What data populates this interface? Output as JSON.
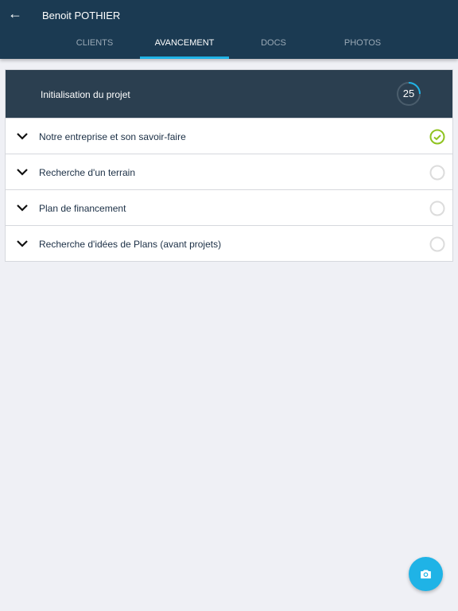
{
  "header": {
    "title": "Benoit POTHIER",
    "back_icon": "arrow-left-icon"
  },
  "tabs": [
    {
      "label": "CLIENTS"
    },
    {
      "label": "AVANCEMENT",
      "active": true
    },
    {
      "label": "DOCS"
    },
    {
      "label": "PHOTOS"
    }
  ],
  "section": {
    "title": "Initialisation du projet",
    "progress": 25,
    "progress_color": "#1fb3e6"
  },
  "items": [
    {
      "label": "Notre entreprise et son savoir-faire",
      "done": true
    },
    {
      "label": "Recherche d'un terrain",
      "done": false
    },
    {
      "label": "Plan de financement",
      "done": false
    },
    {
      "label": "Recherche d'idées de Plans (avant projets)",
      "done": false
    }
  ],
  "fab": {
    "icon": "camera-icon",
    "color": "#1fb3e6"
  }
}
